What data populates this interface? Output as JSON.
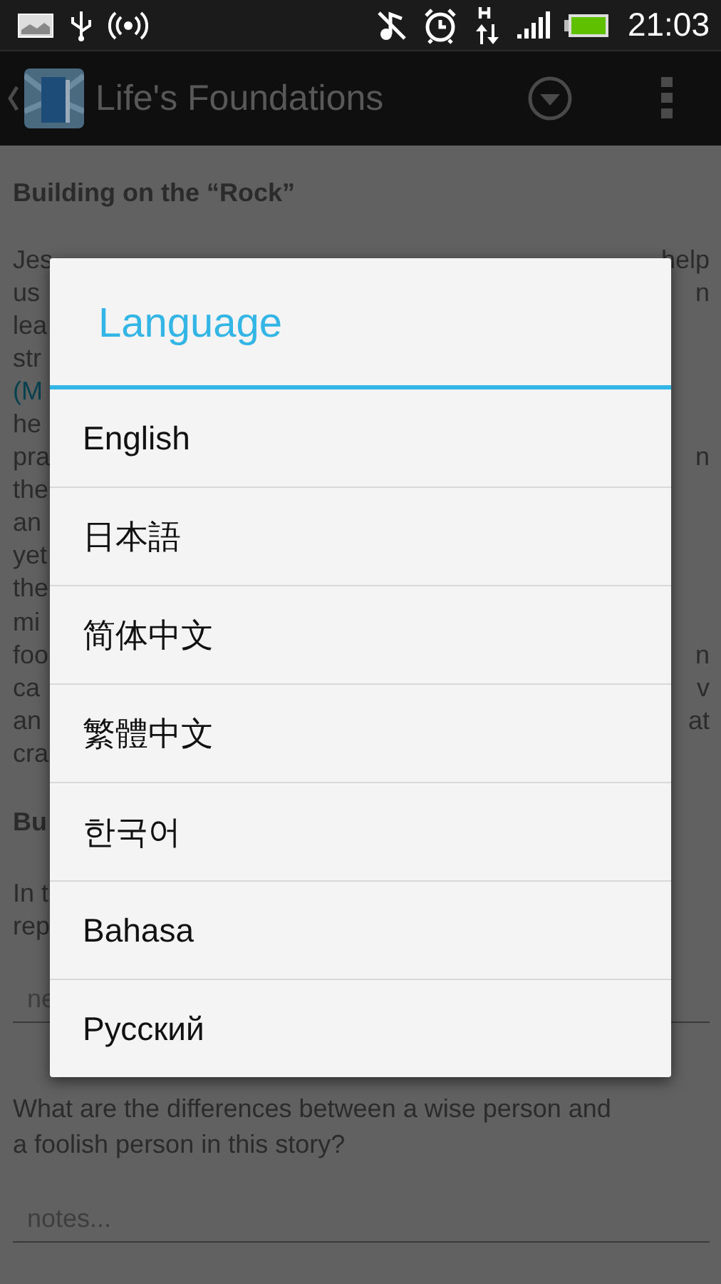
{
  "status_bar": {
    "time": "21:03"
  },
  "action_bar": {
    "title": "Life's Foundations"
  },
  "content": {
    "heading": "Building on the “Rock”",
    "paragraph_lines": [
      {
        "left": "Jes",
        "kind": "text",
        "right": "help"
      },
      {
        "left": "us",
        "kind": "text",
        "right": "n"
      },
      {
        "left": "lea",
        "kind": "text"
      },
      {
        "left": "str",
        "kind": "text"
      },
      {
        "left": "(M",
        "kind": "link"
      },
      {
        "left": "he",
        "kind": "text"
      },
      {
        "left": "pra",
        "kind": "text",
        "right": "n"
      },
      {
        "left": "the",
        "kind": "text"
      },
      {
        "left": "an",
        "kind": "text"
      },
      {
        "left": "yet",
        "kind": "text"
      },
      {
        "left": "the",
        "kind": "text"
      },
      {
        "left": "mi",
        "kind": "text"
      },
      {
        "left": "foo",
        "kind": "text",
        "right": "n"
      },
      {
        "left": "ca",
        "kind": "text",
        "right": "v"
      },
      {
        "left": "an",
        "kind": "text",
        "right": "at"
      },
      {
        "left": "cra",
        "kind": "text"
      }
    ],
    "heading_2": "Bu",
    "question_1_lines": [
      "In t",
      "rep"
    ],
    "notes_field_1": {
      "placeholder": "ne"
    },
    "question_2": "What are the differences between a wise person and a foolish person in this story?",
    "notes_field_2": {
      "placeholder": "notes..."
    }
  },
  "dialog": {
    "title": "Language",
    "items": [
      {
        "label": "English"
      },
      {
        "label": "日本語"
      },
      {
        "label": "简体中文"
      },
      {
        "label": "繁體中文"
      },
      {
        "label": "한국어"
      },
      {
        "label": "Bahasa"
      },
      {
        "label": "Русский"
      }
    ]
  }
}
